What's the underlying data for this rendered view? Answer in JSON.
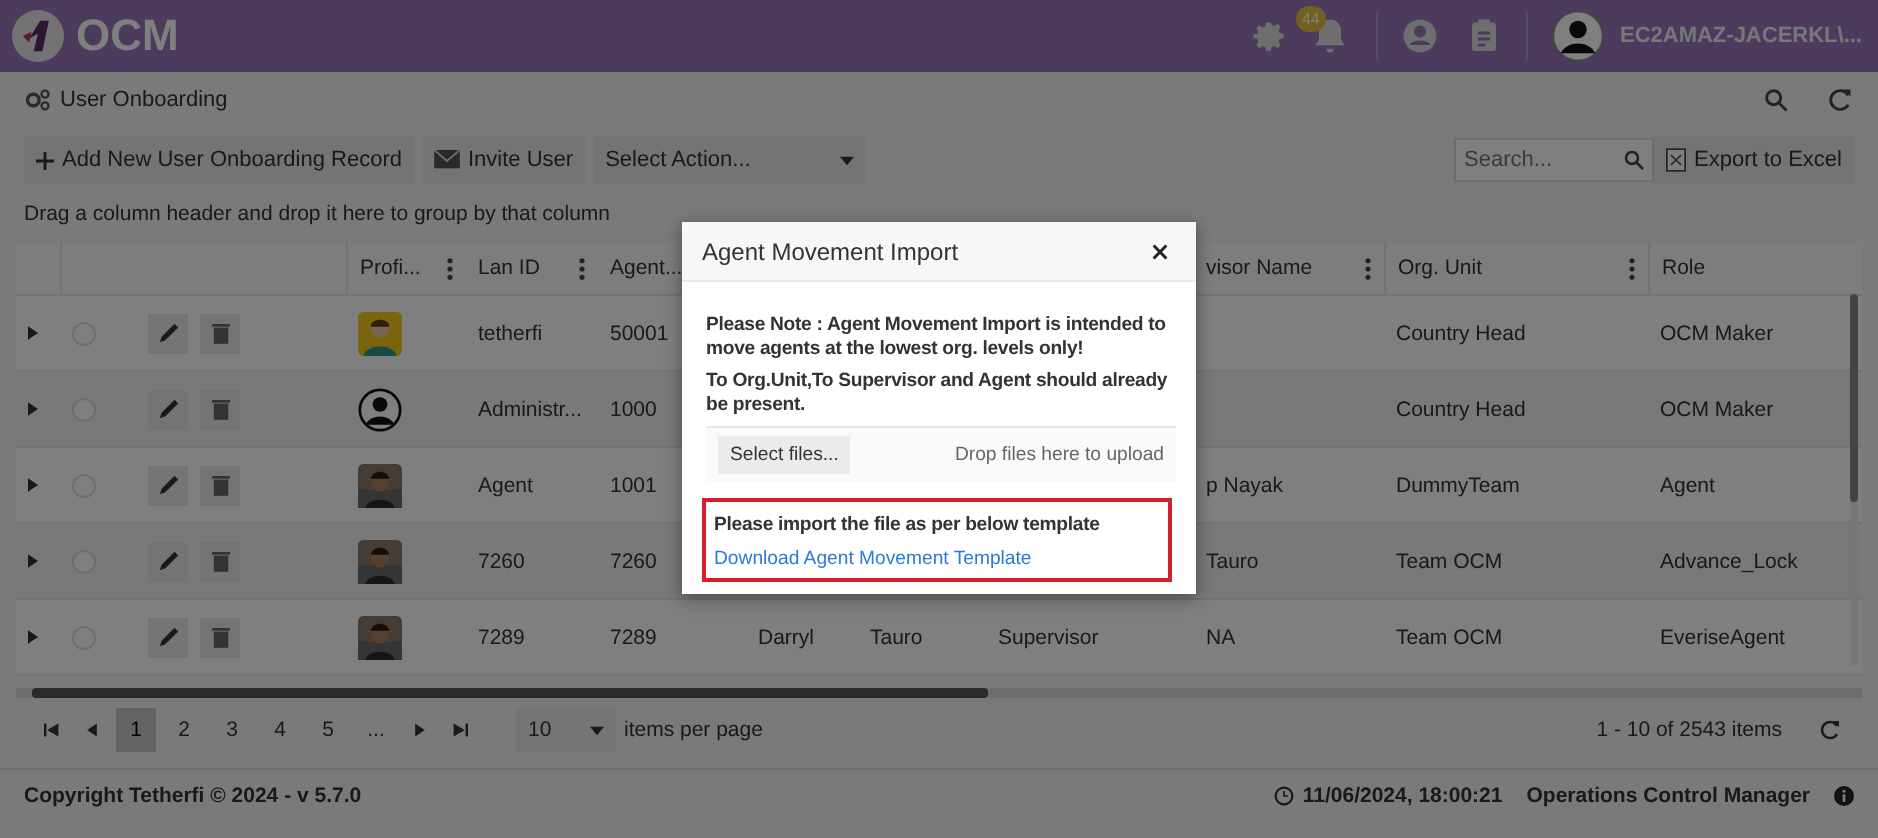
{
  "header": {
    "brand": "OCM",
    "notification_count": "44",
    "user": "EC2AMAZ-JACERKL\\..."
  },
  "page": {
    "title": "User Onboarding"
  },
  "toolbar": {
    "add_button": "Add New User Onboarding Record",
    "invite_button": "Invite User",
    "action_select": "Select Action...",
    "search": {
      "placeholder": "Search..."
    },
    "export_button": "Export to Excel"
  },
  "group_hint": "Drag a column header and drop it here to group by that column",
  "table": {
    "columns": [
      {
        "label": "Profi...",
        "menu": true
      },
      {
        "label": "Lan ID",
        "menu": true
      },
      {
        "label": "Agent...",
        "menu": false
      },
      {
        "label": "visor Name",
        "menu": true
      },
      {
        "label": "Org. Unit",
        "menu": true
      },
      {
        "label": "Role",
        "menu": false
      }
    ],
    "rows": [
      {
        "avatar": {
          "kind": "cartoon"
        },
        "checked": false,
        "lan_id": "tetherfi",
        "agent": "50001",
        "org_unit": "Country Head",
        "role": "OCM Maker"
      },
      {
        "avatar": {
          "kind": "silhouette"
        },
        "checked": false,
        "lan_id": "Administr...",
        "agent": "1000",
        "org_unit": "Country Head",
        "role": "OCM Maker"
      },
      {
        "checked": false,
        "lan_id": "Agent",
        "agent": "1001",
        "supervisor_name": "p Nayak",
        "org_unit": "DummyTeam",
        "role": "Agent"
      },
      {
        "checked": false,
        "lan_id": "7260",
        "agent": "7260",
        "supervisor_name": "Tauro",
        "org_unit": "Team OCM",
        "role": "Advance_Lock"
      },
      {
        "checked": false,
        "lan_id": "7289",
        "agent": "7289",
        "column_7": "Darryl",
        "column_8": "Tauro",
        "column_9": "Supervisor",
        "supervisor_name": "NA",
        "org_unit": "Team OCM",
        "role": "EveriseAgent"
      }
    ]
  },
  "pager": {
    "pages": [
      {
        "label": "1",
        "selected": true
      },
      {
        "label": "2",
        "selected": false
      },
      {
        "label": "3",
        "selected": false
      },
      {
        "label": "4",
        "selected": false
      },
      {
        "label": "5",
        "selected": false
      },
      {
        "label": "...",
        "selected": false
      }
    ],
    "page_size": "10",
    "page_size_label": "items per page",
    "summary": "1 - 10 of 2543 items"
  },
  "footer": {
    "copyright": "Copyright Tetherfi © 2024 - v 5.7.0",
    "timestamp": "11/06/2024, 18:00:21",
    "app_name": "Operations Control Manager"
  },
  "dialog": {
    "title": "Agent Movement Import",
    "note": "Please Note : Agent Movement Import is intended to move agents at the lowest org. levels only!",
    "note2": "To Org.Unit,To Supervisor and Agent should already be present.",
    "select_button": "Select files...",
    "drop_hint": "Drop files here to upload",
    "template_hint": "Please import the file as per below template",
    "template_link": "Download Agent Movement Template",
    "highlighted": true
  }
}
